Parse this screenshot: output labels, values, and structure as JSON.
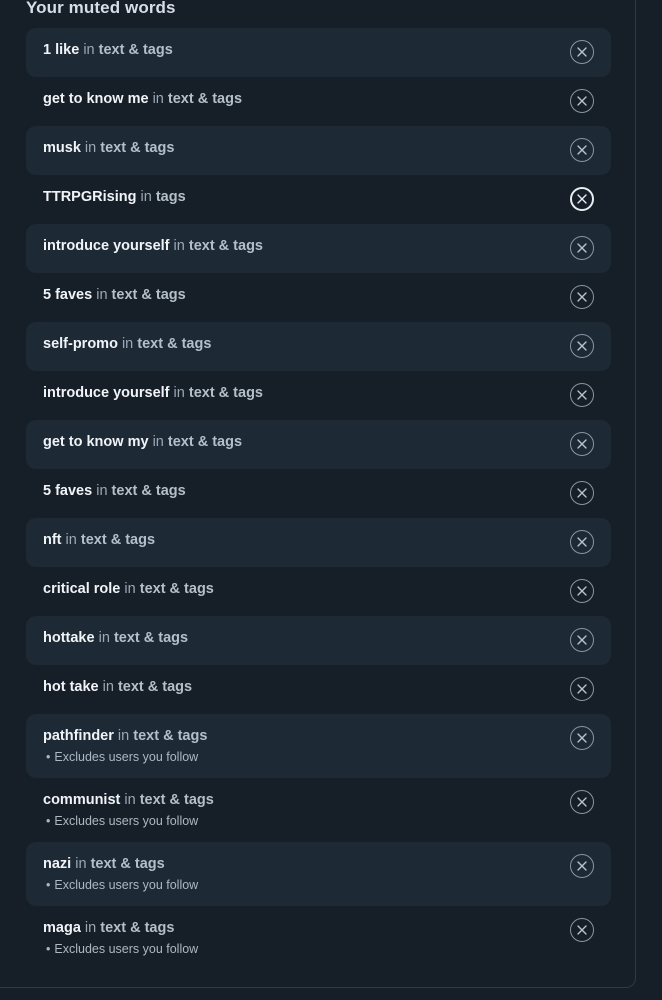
{
  "section": {
    "title": "Your muted words"
  },
  "muted_words": [
    {
      "word": "1 like",
      "scope": "text & tags",
      "shaded": true
    },
    {
      "word": "get to know me",
      "scope": "text & tags",
      "shaded": false
    },
    {
      "word": "musk",
      "scope": "text & tags",
      "shaded": true
    },
    {
      "word": "TTRPGRising",
      "scope": "tags",
      "shaded": false,
      "focused": true
    },
    {
      "word": "introduce yourself",
      "scope": "text & tags",
      "shaded": true
    },
    {
      "word": "5 faves",
      "scope": "text & tags",
      "shaded": false
    },
    {
      "word": "self-promo",
      "scope": "text & tags",
      "shaded": true
    },
    {
      "word": "introduce yourself",
      "scope": "text & tags",
      "shaded": false
    },
    {
      "word": "get to know my",
      "scope": "text & tags",
      "shaded": true
    },
    {
      "word": "5 faves",
      "scope": "text & tags",
      "shaded": false
    },
    {
      "word": "nft",
      "scope": "text & tags",
      "shaded": true
    },
    {
      "word": "critical role",
      "scope": "text & tags",
      "shaded": false
    },
    {
      "word": "hottake",
      "scope": "text & tags",
      "shaded": true
    },
    {
      "word": "hot take",
      "scope": "text & tags",
      "shaded": false
    },
    {
      "word": "pathfinder",
      "scope": "text & tags",
      "shaded": true,
      "note": "Excludes users you follow"
    },
    {
      "word": "communist",
      "scope": "text & tags",
      "shaded": false,
      "note": "Excludes users you follow"
    },
    {
      "word": "nazi",
      "scope": "text & tags",
      "shaded": true,
      "note": "Excludes users you follow"
    },
    {
      "word": "maga",
      "scope": "text & tags",
      "shaded": false,
      "note": "Excludes users you follow"
    }
  ],
  "labels": {
    "in": "in",
    "bullet": "•"
  },
  "icons": {
    "remove": "close-circle-icon"
  },
  "colors": {
    "background": "#161e27",
    "row_shaded": "#1e2936",
    "word_text": "#f1f4f7",
    "scope_text": "#9ba8b6"
  }
}
